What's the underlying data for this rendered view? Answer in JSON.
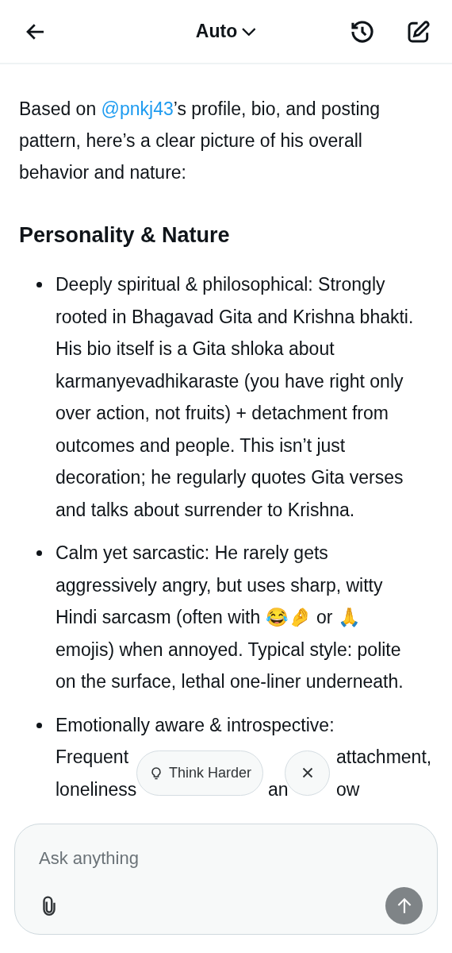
{
  "header": {
    "model": "Auto"
  },
  "intro": {
    "before": "Based on ",
    "mention": "@pnkj43",
    "after": "’s profile, bio, and posting pattern, here’s a clear picture of his overall behavior and nature:"
  },
  "heading": "Personality & Nature",
  "bullets": [
    {
      "text": "Deeply spiritual & philosophical: Strongly rooted in Bhagavad Gita and Krishna bhakti. His bio itself is a Gita shloka about karmanyevadhikaraste (you have right only over action, not fruits) + detachment from outcomes and people. This isn’t just decoration; he regularly quotes Gita verses and talks about surrender to Krishna."
    },
    {
      "text": "Calm yet sarcastic: He rarely gets aggressively angry, but uses sharp, witty Hindi sarcasm (often with 😂🤌 or 🙏 emojis) when annoyed. Typical style: polite on the surface, lethal one-liner underneath."
    }
  ],
  "covered_bullet": {
    "lines": [
      [
        "Emotionally aware & introspective:"
      ],
      [
        "Frequent",
        "attachment,"
      ],
      [
        "loneliness",
        "an",
        "ow"
      ]
    ]
  },
  "suggestion": {
    "label": "Think Harder"
  },
  "composer": {
    "placeholder": "Ask anything"
  }
}
